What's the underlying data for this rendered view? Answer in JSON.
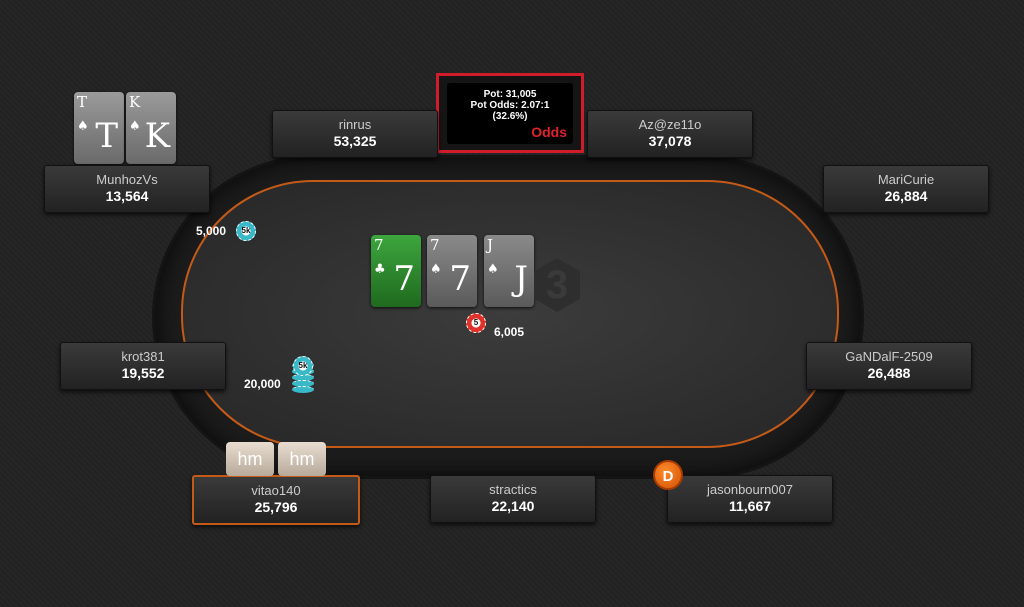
{
  "pot_odds": {
    "pot_line": "Pot: 31,005",
    "odds_line": "Pot Odds: 2.07:1",
    "pct_line": "(32.6%)",
    "label": "Odds"
  },
  "seats": {
    "rinrus": {
      "name": "rinrus",
      "stack": "53,325"
    },
    "az": {
      "name": "Az@ze11o",
      "stack": "37,078"
    },
    "munhoz": {
      "name": "MunhozVs",
      "stack": "13,564"
    },
    "maricurie": {
      "name": "MariCurie",
      "stack": "26,884"
    },
    "krot": {
      "name": "krot381",
      "stack": "19,552"
    },
    "gandalf": {
      "name": "GaNDalF-2509",
      "stack": "26,488"
    },
    "vitao": {
      "name": "vitao140",
      "stack": "25,796"
    },
    "stractics": {
      "name": "stractics",
      "stack": "22,140"
    },
    "jason": {
      "name": "jasonbourn007",
      "stack": "11,667"
    }
  },
  "hole_cards": [
    {
      "rank": "T",
      "suit": "♠"
    },
    {
      "rank": "K",
      "suit": "♠"
    }
  ],
  "board": [
    {
      "rank": "7",
      "suit": "♣"
    },
    {
      "rank": "7",
      "suit": "♠"
    },
    {
      "rank": "J",
      "suit": "♠"
    }
  ],
  "board_ghost": "3",
  "bets": {
    "munhoz": "5,000",
    "krot": "20,000",
    "pot": "6,005"
  },
  "chip_labels": {
    "five_k": "5k",
    "five": "5"
  },
  "dealer_label": "D",
  "hud_buttons": [
    "hm",
    "hm"
  ],
  "colors": {
    "accent": "#c45a17",
    "odds_red": "#e0232e",
    "border_red": "#d11d2b",
    "dealer": "#e8650a"
  }
}
